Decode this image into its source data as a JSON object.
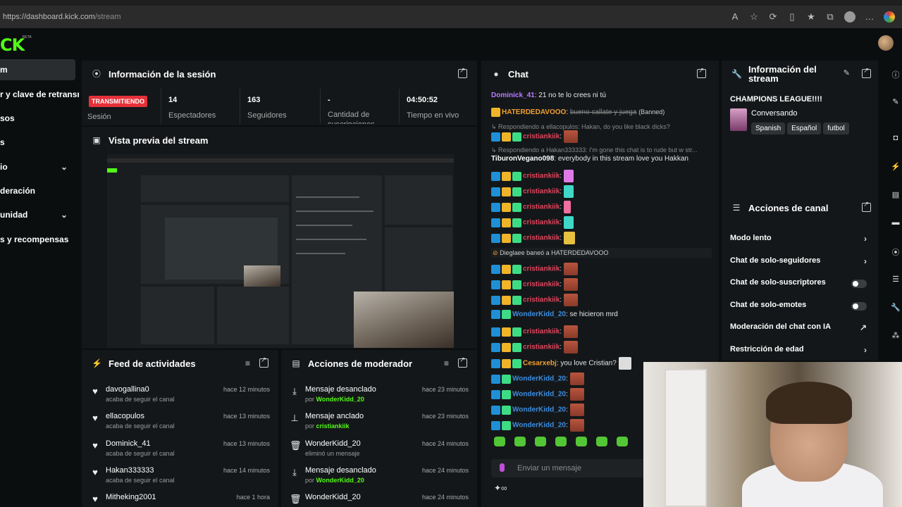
{
  "browser": {
    "url_host": "https://dashboard.kick.com",
    "url_path": "/stream"
  },
  "site": {
    "logo": "CK",
    "beta": "BETA"
  },
  "sidebar": {
    "items": [
      {
        "label": "m"
      },
      {
        "label": "r y clave de retransmi"
      },
      {
        "label": "sos"
      },
      {
        "label": "s"
      },
      {
        "label": "io"
      },
      {
        "label": "deración"
      },
      {
        "label": "unidad"
      },
      {
        "label": "s y recompensas"
      }
    ]
  },
  "session": {
    "title": "Información de la sesión",
    "live_badge": "TRANSMITIENDO",
    "live_label": "Sesión",
    "stats": [
      {
        "value": "14",
        "label": "Espectadores"
      },
      {
        "value": "163",
        "label": "Seguidores"
      },
      {
        "value": "-",
        "label": "Cantidad de suscripciones"
      },
      {
        "value": "04:50:52",
        "label": "Tiempo en vivo"
      }
    ]
  },
  "preview": {
    "title": "Vista previa del stream"
  },
  "feed": {
    "title": "Feed de actividades",
    "items": [
      {
        "name": "davogallina0",
        "sub": "acaba de seguir el canal",
        "time": "hace 12 minutos"
      },
      {
        "name": "ellacopulos",
        "sub": "acaba de seguir el canal",
        "time": "hace 13 minutos"
      },
      {
        "name": "Dominick_41",
        "sub": "acaba de seguir el canal",
        "time": "hace 13 minutos"
      },
      {
        "name": "Hakan333333",
        "sub": "acaba de seguir el canal",
        "time": "hace 14 minutos"
      },
      {
        "name": "Mitheking2001",
        "sub": "",
        "time": "hace 1 hora"
      }
    ]
  },
  "moderator": {
    "title": "Acciones de moderador",
    "items": [
      {
        "title": "Mensaje desanclado",
        "by": "por",
        "user": "WonderKidd_20",
        "time": "hace 23 minutos",
        "icon": "unpin-icon"
      },
      {
        "title": "Mensaje anclado",
        "by": "por",
        "user": "cristiankiik",
        "time": "hace 23 minutos",
        "icon": "pin-icon"
      },
      {
        "title": "WonderKidd_20",
        "by": "eliminó un mensaje",
        "user": "",
        "time": "hace 24 minutos",
        "icon": "trash-icon"
      },
      {
        "title": "Mensaje desanclado",
        "by": "por",
        "user": "WonderKidd_20",
        "time": "hace 24 minutos",
        "icon": "unpin-icon"
      },
      {
        "title": "WonderKidd_20",
        "by": "",
        "user": "",
        "time": "hace 24 minutos",
        "icon": "trash-icon"
      }
    ]
  },
  "chat": {
    "title": "Chat",
    "input_placeholder": "Enviar un mensaje",
    "l1_user": "Dominick_41",
    "l1_msg": ": 21 no te lo crees ni tú",
    "l2_user": "HATERDEDAVOOO",
    "l2_msg": "bueno callate y juega",
    "l2_tag": "(Banned)",
    "l3_reply": "Respondiendo a ellacopulos: Hakan, do you like black dicks?",
    "l3_user": "cristiankiik",
    "l4_reply": "Respondiendo a Hakan333333: I'm gone this chat is to rude but w str...",
    "l5_user": "TiburonVegano098",
    "l5_msg": ": everybody in this stream love you Hakkan",
    "repeat_user": "cristiankiik",
    "ban_user": "Dieglaee",
    "ban_text": "baneó a HATERDEDAVOOO",
    "wk_user": "WonderKidd_20",
    "wk_msg": ": se hicieron mrd",
    "cz_user": "Cesarxebj",
    "cz_msg": ": you love Cristian?"
  },
  "stream_info": {
    "title": "Información del stream",
    "stream_title": "CHAMPIONS LEAGUE!!!!",
    "category": "Conversando",
    "tags": [
      "Spanish",
      "Español",
      "futbol"
    ]
  },
  "channel_actions": {
    "title": "Acciones de canal",
    "items": [
      {
        "label": "Modo lento",
        "control": "chevron"
      },
      {
        "label": "Chat de solo-seguidores",
        "control": "chevron"
      },
      {
        "label": "Chat de solo-suscriptores",
        "control": "toggle"
      },
      {
        "label": "Chat de solo-emotes",
        "control": "toggle"
      },
      {
        "label": "Moderación del chat con IA",
        "control": "external"
      },
      {
        "label": "Restricción de edad",
        "control": "chevron"
      }
    ]
  },
  "colors": {
    "brand": "#53fc18",
    "live": "#e5313a",
    "panel": "#141719",
    "page": "#0b0e0f"
  }
}
